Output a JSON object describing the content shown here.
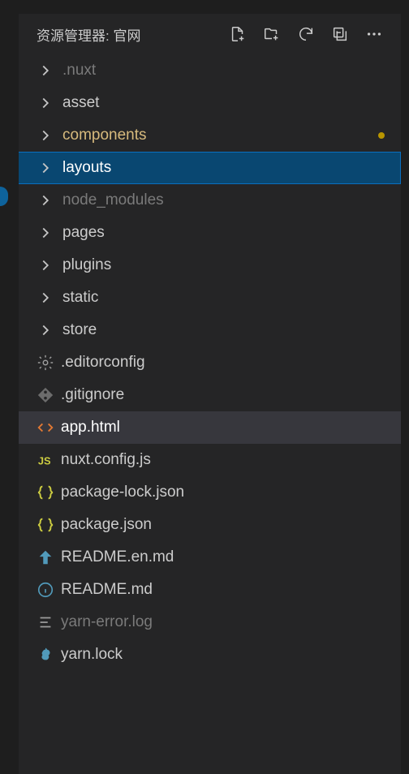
{
  "header": {
    "title": "资源管理器: 官网"
  },
  "tree": {
    "items": {
      "nuxt": {
        "label": ".nuxt"
      },
      "asset": {
        "label": "asset"
      },
      "components": {
        "label": "components"
      },
      "layouts": {
        "label": "layouts"
      },
      "nodeModules": {
        "label": "node_modules"
      },
      "pages": {
        "label": "pages"
      },
      "plugins": {
        "label": "plugins"
      },
      "static": {
        "label": "static"
      },
      "store": {
        "label": "store"
      },
      "editorconfig": {
        "label": ".editorconfig"
      },
      "gitignore": {
        "label": ".gitignore"
      },
      "appHtml": {
        "label": "app.html"
      },
      "nuxtConfig": {
        "label": "nuxt.config.js"
      },
      "packageLock": {
        "label": "package-lock.json"
      },
      "packageJson": {
        "label": "package.json"
      },
      "readmeEn": {
        "label": "README.en.md"
      },
      "readme": {
        "label": "README.md"
      },
      "yarnError": {
        "label": "yarn-error.log"
      },
      "yarnLock": {
        "label": "yarn.lock"
      }
    }
  }
}
